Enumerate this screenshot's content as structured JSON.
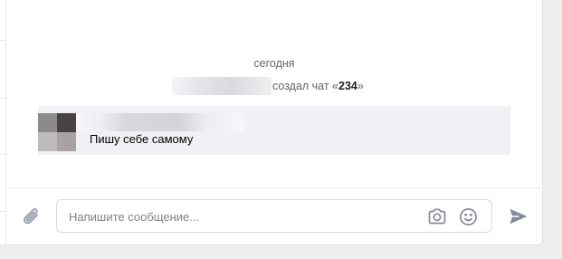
{
  "chat": {
    "date_separator": "сегодня",
    "service_message": {
      "action_text": "создал чат «",
      "chat_name": "234",
      "closing_quote": "»"
    },
    "messages": [
      {
        "text": "Пишу себе самому"
      }
    ]
  },
  "composer": {
    "placeholder": "Напишите сообщение..."
  },
  "icons": {
    "attach": "paperclip-icon",
    "camera": "camera-icon",
    "emoji": "smile-icon",
    "send": "send-icon"
  },
  "colors": {
    "accent": "#828a99",
    "message_bg": "#f0f1f4",
    "muted_text": "#656565",
    "page_bg": "#edeef0"
  }
}
